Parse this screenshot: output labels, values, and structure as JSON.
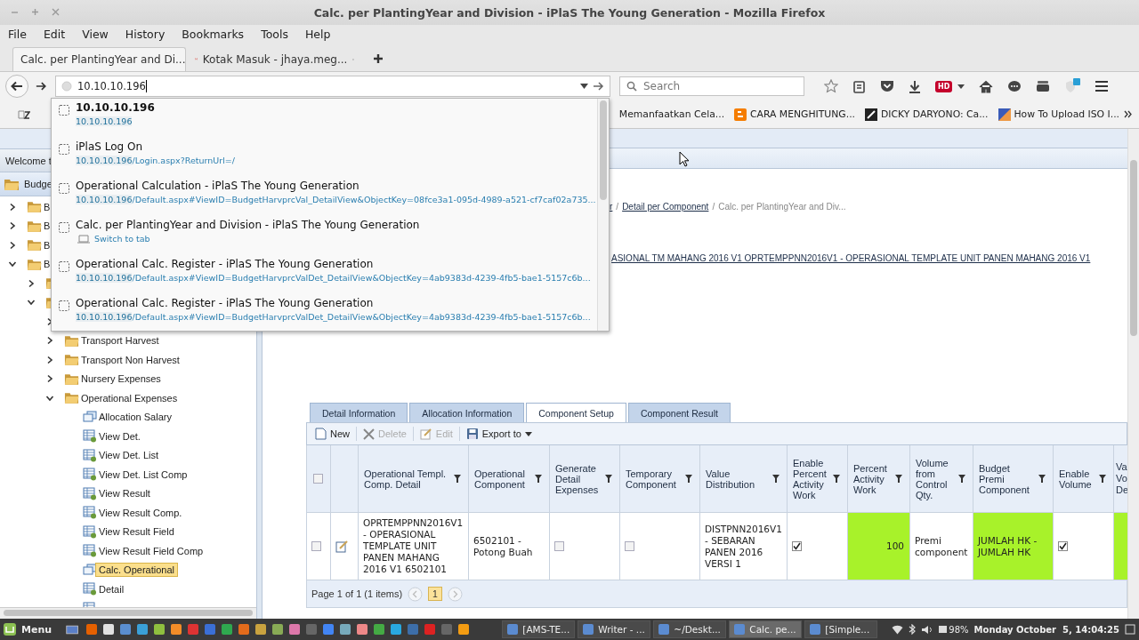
{
  "window": {
    "title": "Calc. per PlantingYear and Division - iPlaS The Young Generation - Mozilla Firefox"
  },
  "menu": [
    "File",
    "Edit",
    "View",
    "History",
    "Bookmarks",
    "Tools",
    "Help"
  ],
  "tabs": [
    {
      "label": "Calc. per PlantingYear and Di...",
      "selected": true,
      "kind": "page"
    },
    {
      "label": "Kotak Masuk - jhaya.meg...",
      "selected": false,
      "kind": "mail"
    }
  ],
  "address": {
    "value": "10.10.10.196"
  },
  "search": {
    "placeholder": "Search"
  },
  "hd_badge": "HD",
  "bookmarks": [
    {
      "label": "Memanfaatkan Cela...",
      "kind": "page"
    },
    {
      "label": "CARA MENGHITUNG...",
      "kind": "blogger"
    },
    {
      "label": "DICKY DARYONO: Ca...",
      "kind": "dark"
    },
    {
      "label": "How To Upload ISO I...",
      "kind": "colorful"
    }
  ],
  "suggestions": [
    {
      "kind": "typed",
      "title": "10.10.10.196",
      "url_host": "10.10.10.196"
    },
    {
      "kind": "history",
      "title": "iPlaS Log On",
      "url_host": "10.10.10.196",
      "url_rest": "/Login.aspx?ReturnUrl=/"
    },
    {
      "kind": "history",
      "title": "Operational Calculation - iPlaS The Young Generation",
      "url_host": "10.10.10.196",
      "url_rest": "/Default.aspx#ViewID=BudgetHarvprcVal_DetailView&ObjectKey=08fce3a1-095d-4989-a521-cf7caf02a735..."
    },
    {
      "kind": "tab",
      "title": "Calc. per PlantingYear and Division - iPlaS The Young Generation",
      "action": "Switch to tab"
    },
    {
      "kind": "history",
      "title": "Operational Calc. Register - iPlaS The Young Generation",
      "url_host": "10.10.10.196",
      "url_rest": "/Default.aspx#ViewID=BudgetHarvprcValDet_DetailView&ObjectKey=4ab9383d-4239-4fb5-bae1-5157c6b..."
    },
    {
      "kind": "history",
      "title": "Operational Calc. Register - iPlaS The Young Generation",
      "url_host": "10.10.10.196",
      "url_rest": "/Default.aspx#ViewID=BudgetHarvprcValDet_DetailView&ObjectKey=4ab9383d-4239-4fb5-bae1-5157c6b..."
    }
  ],
  "sidebar": {
    "welcome": "Welcome t",
    "root": "Budge",
    "tree": [
      {
        "label": "B",
        "kind": "folder",
        "expanded": false,
        "selected": false
      },
      {
        "label": "B",
        "kind": "folder",
        "expanded": false,
        "selected": false
      },
      {
        "label": "B",
        "kind": "folder",
        "expanded": false,
        "selected": false
      },
      {
        "label": "B",
        "kind": "folder",
        "expanded": true,
        "selected": false,
        "children": [
          {
            "kind": "folder",
            "expanded": false
          },
          {
            "kind": "folder",
            "expanded": true,
            "children": [
              {
                "kind": "stub",
                "expanded": false
              },
              {
                "label": "Transport Harvest",
                "kind": "folder",
                "expanded": false,
                "selected": false
              },
              {
                "label": "Transport Non Harvest",
                "kind": "folder",
                "expanded": false,
                "selected": false
              },
              {
                "label": "Nursery Expenses",
                "kind": "folder",
                "expanded": false,
                "selected": false
              },
              {
                "label": "Operational Expenses",
                "kind": "folder",
                "expanded": true,
                "selected": false,
                "children": [
                  {
                    "label": "Allocation Salary",
                    "kind": "calc",
                    "selected": false
                  },
                  {
                    "label": "View Det.",
                    "kind": "view",
                    "selected": false
                  },
                  {
                    "label": "View Det. List",
                    "kind": "view",
                    "selected": false
                  },
                  {
                    "label": "View Det. List Comp",
                    "kind": "view",
                    "selected": false
                  },
                  {
                    "label": "View Result",
                    "kind": "view",
                    "selected": false
                  },
                  {
                    "label": "View Result Comp.",
                    "kind": "view",
                    "selected": false
                  },
                  {
                    "label": "View Result Field",
                    "kind": "view",
                    "selected": false
                  },
                  {
                    "label": "View Result Field Comp",
                    "kind": "view",
                    "selected": false
                  },
                  {
                    "label": "Calc. Operational",
                    "kind": "calc",
                    "selected": true
                  },
                  {
                    "label": "Detail",
                    "kind": "view",
                    "selected": false
                  },
                  {
                    "kind": "view"
                  }
                ]
              }
            ]
          }
        ]
      }
    ]
  },
  "breadcrumb": {
    "partial_link": "r",
    "separator": "/",
    "link": "Detail per Component",
    "current": "Calc. per PlantingYear and Div..."
  },
  "record_title": "ASIONAL TM MAHANG 2016 V1 OPRTEMPPNN2016V1 - OPERASIONAL TEMPLATE UNIT PANEN MAHANG 2016 V1",
  "detail_tabs": [
    {
      "label": "Detail Information",
      "selected": false
    },
    {
      "label": "Allocation Information",
      "selected": false
    },
    {
      "label": "Component Setup",
      "selected": true
    },
    {
      "label": "Component Result",
      "selected": false
    }
  ],
  "toolbar": [
    {
      "label": "New",
      "kind": "new",
      "disabled": false
    },
    {
      "label": "Delete",
      "kind": "delete",
      "disabled": true
    },
    {
      "label": "Edit",
      "kind": "edit",
      "disabled": true
    },
    {
      "label": "Export to",
      "kind": "export",
      "disabled": false
    }
  ],
  "table": {
    "all_selected": false,
    "columns": [
      {
        "label": "Operational Templ. Comp. Detail",
        "kind": "full"
      },
      {
        "label": "Operational Component",
        "kind": "full"
      },
      {
        "label": "Generate Detail Expenses",
        "kind": "full"
      },
      {
        "label": "Temporary Component",
        "kind": "full"
      },
      {
        "label": "Value Distribution",
        "kind": "full"
      },
      {
        "label": "Enable Percent Activity Work",
        "kind": "full"
      },
      {
        "label": "Percent Activity Work",
        "kind": "full"
      },
      {
        "label": "Volume from Control Qty.",
        "kind": "full"
      },
      {
        "label": "Budget Premi Component",
        "kind": "full"
      },
      {
        "label": "Enable Volume",
        "kind": "full"
      },
      {
        "label": "Va Vo De",
        "kind": "partial"
      }
    ],
    "rows": [
      {
        "selected": false,
        "cells": [
          {
            "kind": "text",
            "text": "OPRTEMPPNN2016V1 - OPERASIONAL TEMPLATE UNIT PANEN MAHANG 2016 V1 6502101",
            "highlight": false
          },
          {
            "kind": "text",
            "text": "6502101 - Potong Buah",
            "highlight": false
          },
          {
            "kind": "check",
            "checked": false,
            "highlight": false
          },
          {
            "kind": "check",
            "checked": false,
            "highlight": false
          },
          {
            "kind": "text",
            "text": "DISTPNN2016V1 - SEBARAN PANEN 2016 VERSI 1",
            "highlight": false
          },
          {
            "kind": "check",
            "checked": true,
            "highlight": false
          },
          {
            "kind": "number",
            "text": "100",
            "highlight": true
          },
          {
            "kind": "text",
            "text": "Premi component",
            "highlight": false
          },
          {
            "kind": "text",
            "text": "JUMLAH HK - JUMLAH HK",
            "highlight": true
          },
          {
            "kind": "check",
            "checked": true,
            "highlight": false
          },
          {
            "kind": "blank",
            "highlight": true
          }
        ]
      }
    ]
  },
  "pager": {
    "summary": "Page 1 of 1 (1 items)",
    "pages": [
      {
        "label": "1",
        "selected": true
      }
    ]
  },
  "taskbar": {
    "menu": "Menu",
    "tasks": [
      {
        "label": "[AMS-TE...",
        "selected": false
      },
      {
        "label": "Writer - ...",
        "selected": false
      },
      {
        "label": "~/Deskt...",
        "selected": false
      },
      {
        "label": "Calc. pe...",
        "selected": true
      },
      {
        "label": "[Simple...",
        "selected": false
      }
    ],
    "battery": "98%",
    "clock": "Monday October  5, 14:04:25"
  }
}
